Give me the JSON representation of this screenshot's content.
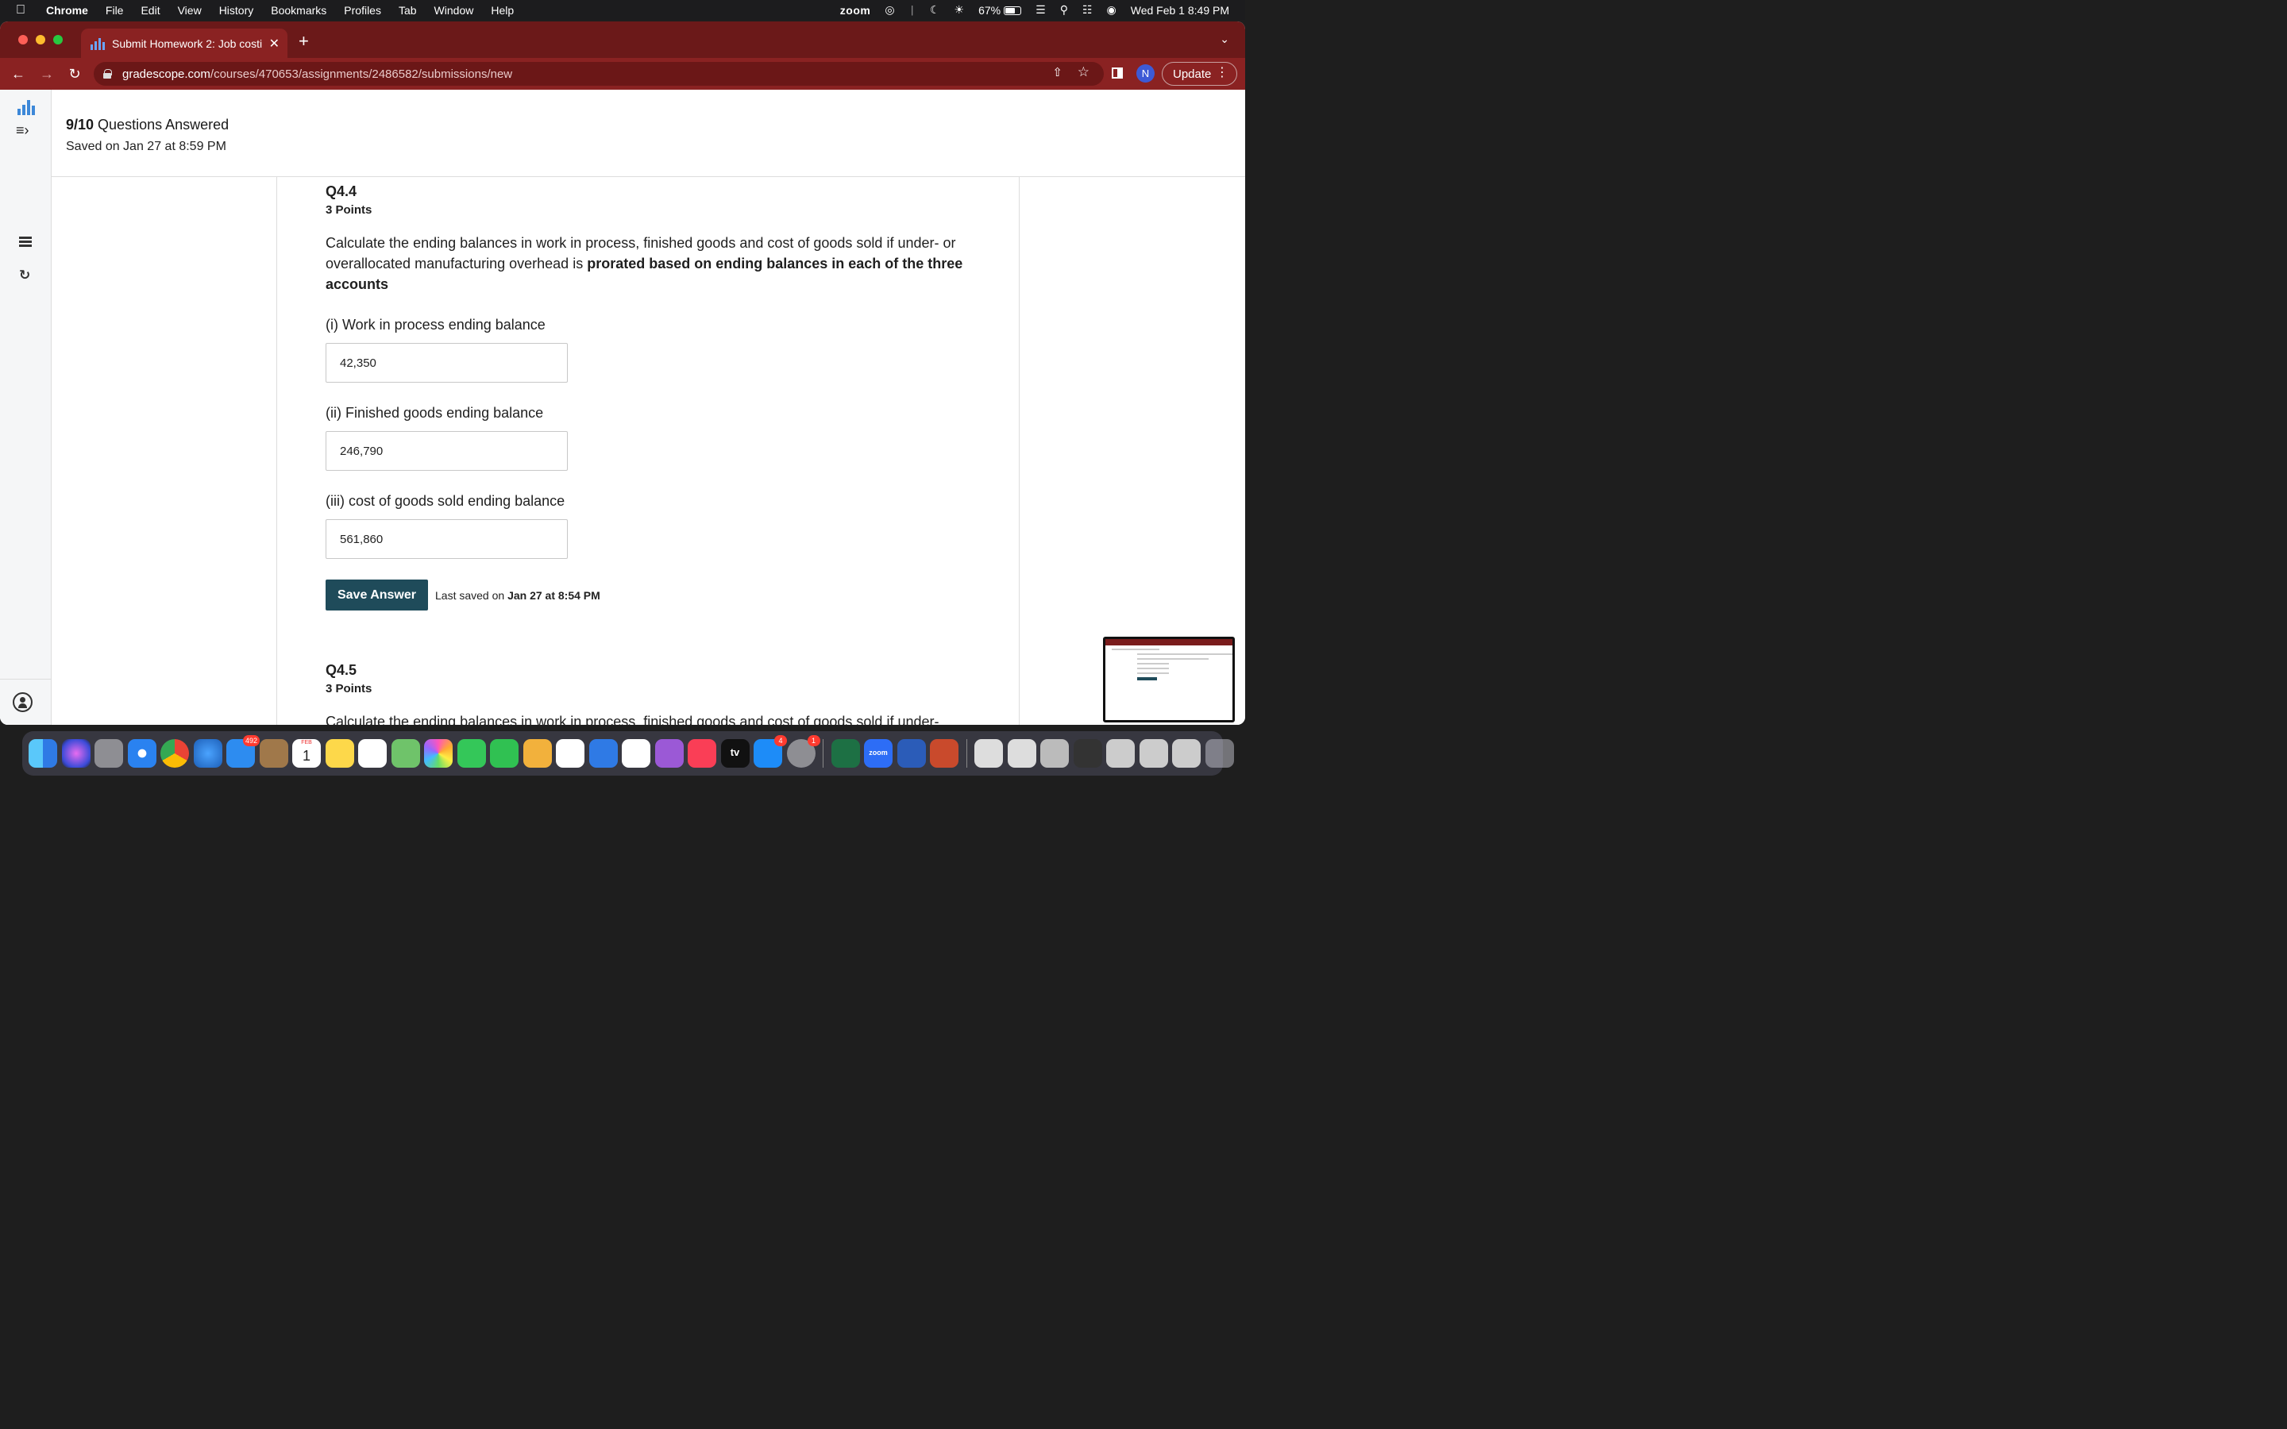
{
  "menubar": {
    "app": "Chrome",
    "items": [
      "File",
      "Edit",
      "View",
      "History",
      "Bookmarks",
      "Profiles",
      "Tab",
      "Window",
      "Help"
    ],
    "zoom": "zoom",
    "battery": "67%",
    "datetime": "Wed Feb 1  8:49 PM"
  },
  "browser": {
    "tab_title": "Submit Homework 2: Job costi",
    "url_host": "gradescope.com",
    "url_path": "/courses/470653/assignments/2486582/submissions/new",
    "profile_initial": "N",
    "update_label": "Update"
  },
  "header": {
    "answered_count": "9/10",
    "answered_label": " Questions Answered",
    "saved_text": "Saved on Jan 27 at 8:59 PM"
  },
  "q44": {
    "number": "Q4.4",
    "points": "3 Points",
    "text_plain": "Calculate the ending balances in work in process, finished goods and cost of goods sold if under- or overallocated manufacturing overhead is ",
    "text_bold": "prorated based on ending balances in each of the three accounts",
    "fields": [
      {
        "label": "(i) Work in process ending balance",
        "value": "42,350"
      },
      {
        "label": "(ii) Finished goods ending balance",
        "value": "246,790"
      },
      {
        "label": "(iii) cost of goods sold ending balance",
        "value": "561,860"
      }
    ],
    "save_label": "Save Answer",
    "last_saved_prefix": "Last saved on ",
    "last_saved_time": "Jan 27 at 8:54 PM"
  },
  "q45": {
    "number": "Q4.5",
    "points": "3 Points",
    "text_plain": "Calculate the ending balances in work in process, finished goods and cost of goods sold if under-"
  },
  "dock": {
    "mail_badge": "492",
    "calendar_month": "FEB",
    "calendar_day": "1",
    "tv_label": "tv",
    "appstore_badge": "4",
    "settings_badge": "1",
    "zoom_label": "zoom"
  },
  "colors": {
    "chrome_frame": "#6b1919",
    "chrome_toolbar": "#8a2222",
    "save_button": "#1f4b5a",
    "gradescope_blue": "#3d88d8"
  }
}
